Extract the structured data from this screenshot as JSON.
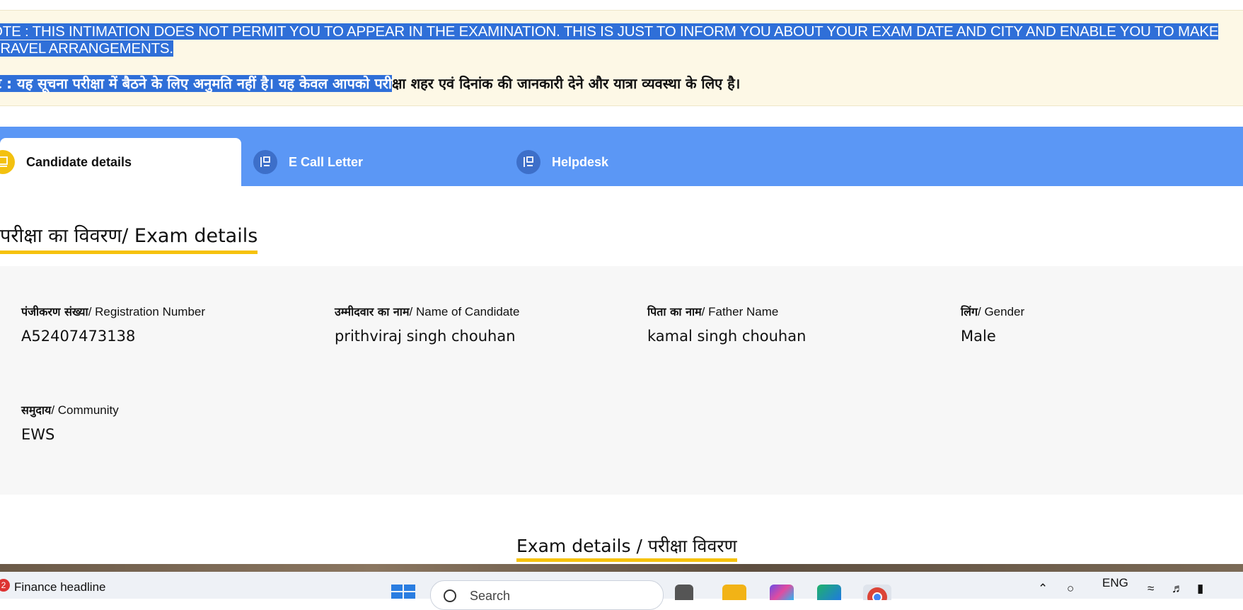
{
  "notice": {
    "english_selected": "OTE : THIS INTIMATION DOES NOT PERMIT YOU TO APPEAR IN THE EXAMINATION. THIS IS JUST TO INFORM YOU ABOUT YOUR EXAM DATE AND CITY AND ENABLE YOU TO MAKE TRAVEL ARRANGEMENTS.",
    "hindi_selected": "ट : यह सूचना परीक्षा में बैठने के लिए अनुमति नहीं है। यह केवल आपको परी",
    "hindi_rest": "क्षा शहर एवं दिनांक की जानकारी देने और यात्रा व्यवस्था के लिए है।"
  },
  "tabs": [
    {
      "label": "Candidate details",
      "active": true
    },
    {
      "label": "E Call Letter",
      "active": false
    },
    {
      "label": "Helpdesk",
      "active": false
    }
  ],
  "section_title": "परीक्षा का विवरण/ Exam details",
  "fields": {
    "registration": {
      "label_hi": "पंजीकरण संख्या",
      "label_en": "/ Registration Number",
      "value": "A52407473138"
    },
    "name": {
      "label_hi": "उम्मीदवार का नाम",
      "label_en": "/ Name of Candidate",
      "value": "prithviraj singh chouhan"
    },
    "father": {
      "label_hi": "पिता का नाम",
      "label_en": "/ Father Name",
      "value": "kamal singh chouhan"
    },
    "gender": {
      "label_hi": "लिंग",
      "label_en": "/ Gender",
      "value": "Male"
    },
    "community": {
      "label_hi": "समुदाय",
      "label_en": "/ Community",
      "value": "EWS"
    }
  },
  "section2_title": "Exam details / परीक्षा विवरण",
  "taskbar": {
    "badge_count": "2",
    "news": "Finance headline",
    "search_placeholder": "Search",
    "language": "ENG"
  },
  "colors": {
    "tab_bar": "#5b97f5",
    "accent_yellow": "#f6c20b",
    "notice_bg": "#fdf8e6",
    "selection": "#2f6fd8"
  }
}
